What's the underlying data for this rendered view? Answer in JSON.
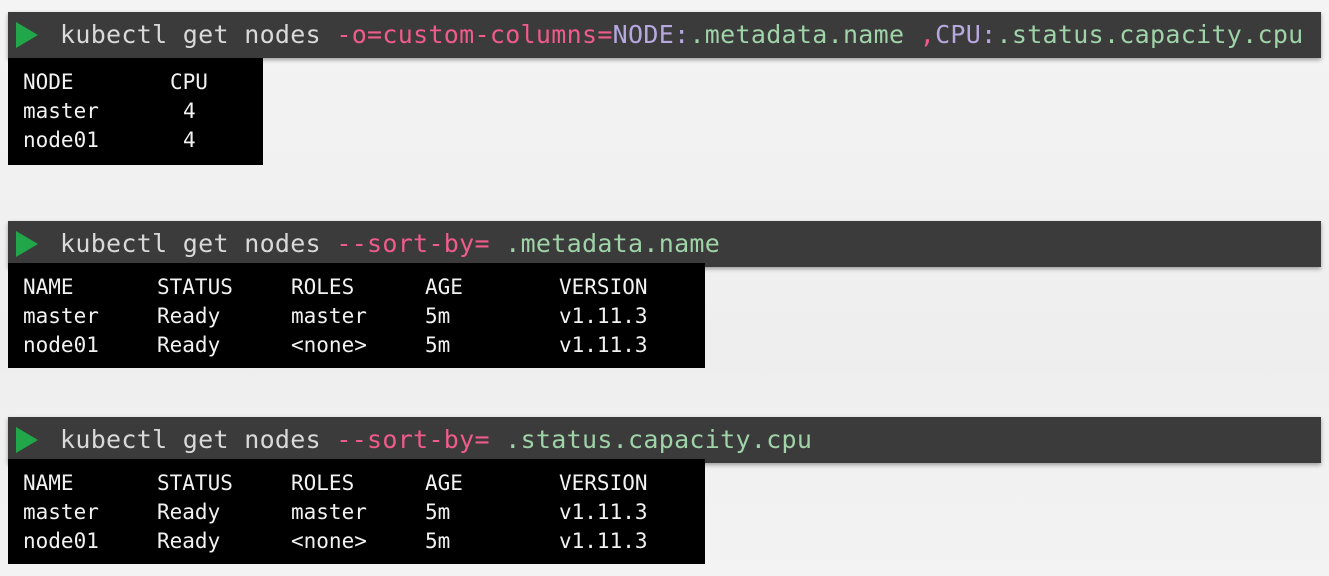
{
  "blocks": [
    {
      "command": {
        "base": "kubectl get nodes",
        "flag": "-o=custom-columns=",
        "part1_key": "NODE",
        "part1_colon": ":",
        "part1_path": ".metadata.name",
        "sep": ",",
        "part2_key": "CPU",
        "part2_colon": ":",
        "part2_path": ".status.capacity.cpu"
      },
      "output": {
        "headers": [
          "NODE",
          "CPU"
        ],
        "rows": [
          [
            "master",
            "4"
          ],
          [
            "node01",
            "4"
          ]
        ]
      }
    },
    {
      "command": {
        "base": "kubectl get nodes",
        "flag": "--sort-by=",
        "arg": ".metadata.name"
      },
      "output": {
        "headers": [
          "NAME",
          "STATUS",
          "ROLES",
          "AGE",
          "VERSION"
        ],
        "rows": [
          [
            "master",
            "Ready",
            "master",
            "5m",
            "v1.11.3"
          ],
          [
            "node01",
            "Ready",
            "<none>",
            "5m",
            "v1.11.3"
          ]
        ]
      }
    },
    {
      "command": {
        "base": "kubectl get nodes",
        "flag": "--sort-by=",
        "arg": ".status.capacity.cpu"
      },
      "output": {
        "headers": [
          "NAME",
          "STATUS",
          "ROLES",
          "AGE",
          "VERSION"
        ],
        "rows": [
          [
            "master",
            "Ready",
            "master",
            "5m",
            "v1.11.3"
          ],
          [
            "node01",
            "Ready",
            "<none>",
            "5m",
            "v1.11.3"
          ]
        ]
      }
    }
  ],
  "colors": {
    "prompt": "#22a64a",
    "flag": "#ef5b8a",
    "field_key": "#b7a8e0",
    "path": "#9fd3a8",
    "bar_bg": "#3b3b3b",
    "output_bg": "#000000"
  }
}
